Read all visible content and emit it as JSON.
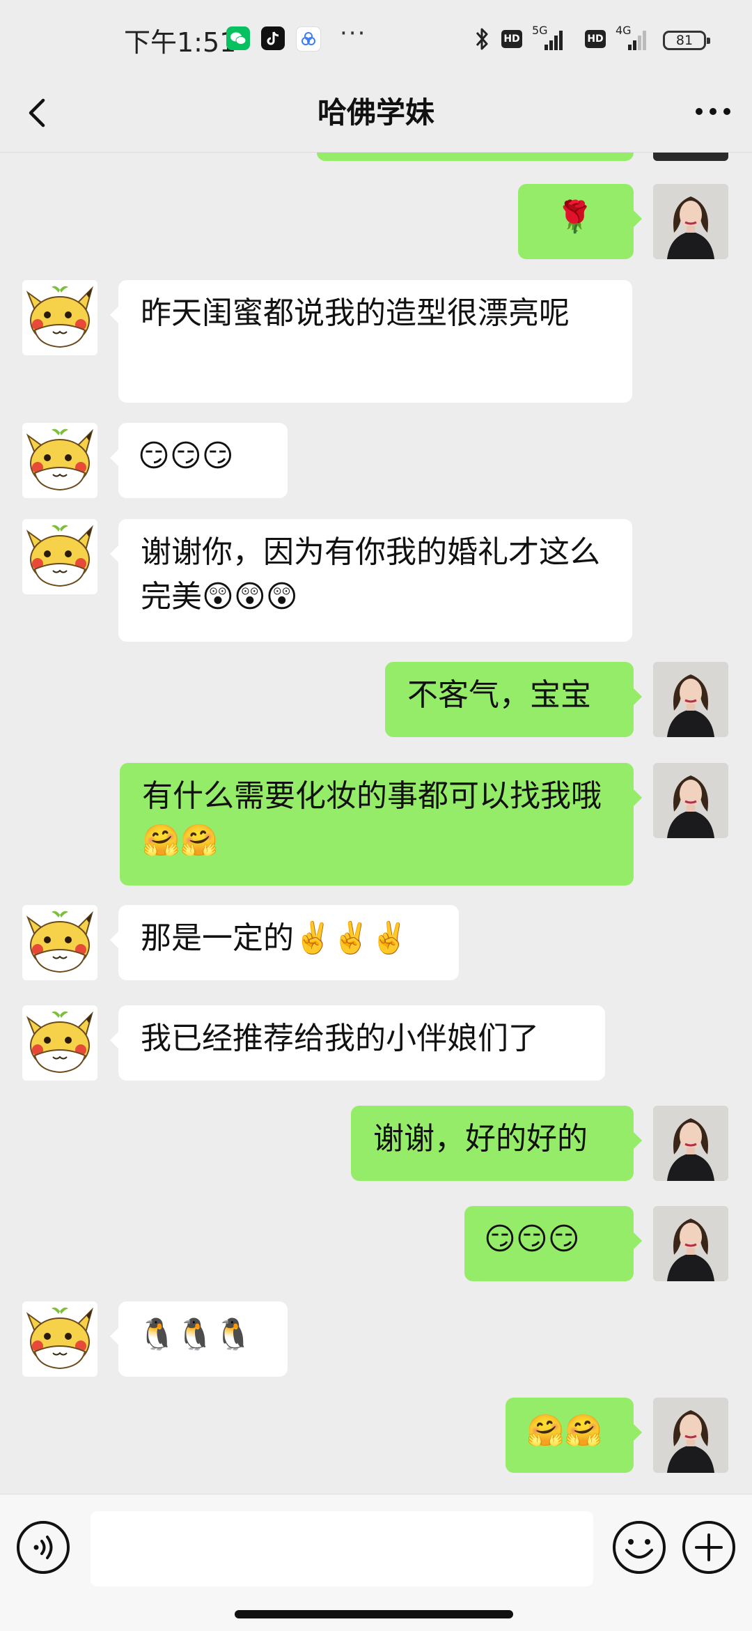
{
  "status_bar": {
    "time": "下午1:51",
    "network_1": "5G",
    "network_2": "4G",
    "hd_1": "HD",
    "hd_2": "HD",
    "battery": "81"
  },
  "nav": {
    "title": "哈佛学妹"
  },
  "messages": [
    {
      "side": "out",
      "text": "🌹"
    },
    {
      "side": "in",
      "text": "昨天闺蜜都说我的造型很漂亮呢"
    },
    {
      "side": "in",
      "text": "😏😏😏"
    },
    {
      "side": "in",
      "text": "谢谢你，因为有你我的婚礼才这么完美😲😲😲"
    },
    {
      "side": "out",
      "text": "不客气，宝宝"
    },
    {
      "side": "out",
      "text": "有什么需要化妆的事都可以找我哦🤗🤗"
    },
    {
      "side": "in",
      "text": "那是一定的✌️✌️✌️"
    },
    {
      "side": "in",
      "text": "我已经推荐给我的小伴娘们了"
    },
    {
      "side": "out",
      "text": "谢谢，好的好的"
    },
    {
      "side": "out",
      "text": "😏😏😏"
    },
    {
      "side": "in",
      "text": "🐧🐧🐧"
    },
    {
      "side": "out",
      "text": "🤗🤗"
    }
  ],
  "colors": {
    "background": "#ededed",
    "outgoing_bubble": "#95ec69",
    "incoming_bubble": "#ffffff"
  },
  "icons": {
    "back": "chevron-left-icon",
    "more": "more-dots-icon",
    "voice": "voice-icon",
    "emoji": "emoji-icon",
    "plus": "plus-icon"
  }
}
